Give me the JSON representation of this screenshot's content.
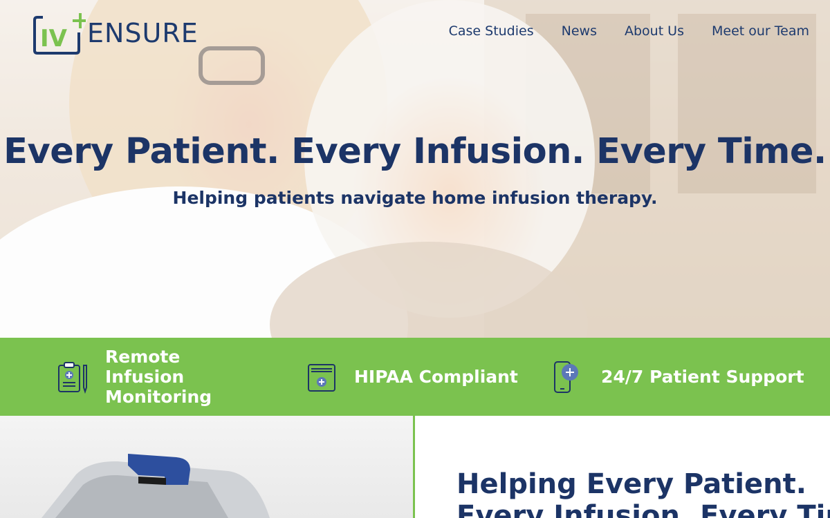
{
  "brand": {
    "logo_prefix": "IV",
    "logo_word": "ENSURE",
    "green": "#7bc24f",
    "navy": "#1c3466"
  },
  "nav": {
    "items": [
      "Case Studies",
      "News",
      "About Us",
      "Meet our Team"
    ]
  },
  "hero": {
    "title": "Every Patient. Every Infusion. Every Time.",
    "subtitle": "Helping patients navigate home infusion therapy."
  },
  "features": [
    {
      "label": "Remote Infusion Monitoring",
      "icon": "clipboard-medical-icon"
    },
    {
      "label": "HIPAA Compliant",
      "icon": "secure-folder-icon"
    },
    {
      "label": "24/7 Patient Support",
      "icon": "phone-chat-icon"
    }
  ],
  "section": {
    "title_line1": "Helping Every Patient.",
    "title_line2": "Every Infusion. Every Time."
  }
}
